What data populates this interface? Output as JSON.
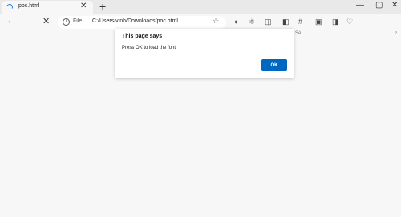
{
  "tab": {
    "title": "poc.html",
    "close": "✕"
  },
  "new_tab": "+",
  "window": {
    "minimize": "—",
    "maximize": "▢",
    "close": "✕"
  },
  "toolbar": {
    "back": "←",
    "forward": "→",
    "stop": "✕",
    "info": "i",
    "scheme_label": "File",
    "url": "C:/Users/vinh/Downloads/poc.html",
    "favorite": "☆",
    "extensions": [
      "◐",
      "⚛",
      "◫",
      "◧",
      "#",
      "▣",
      "◨",
      "♡"
    ]
  },
  "favbar": {
    "truncated": "Sé...",
    "more": "›"
  },
  "dialog": {
    "heading": "This page says",
    "message": "Press OK to load the font",
    "ok_label": "OK"
  },
  "colors": {
    "accent": "#0067c0",
    "chrome": "#e9e9e9",
    "page": "#f7f7f7"
  }
}
